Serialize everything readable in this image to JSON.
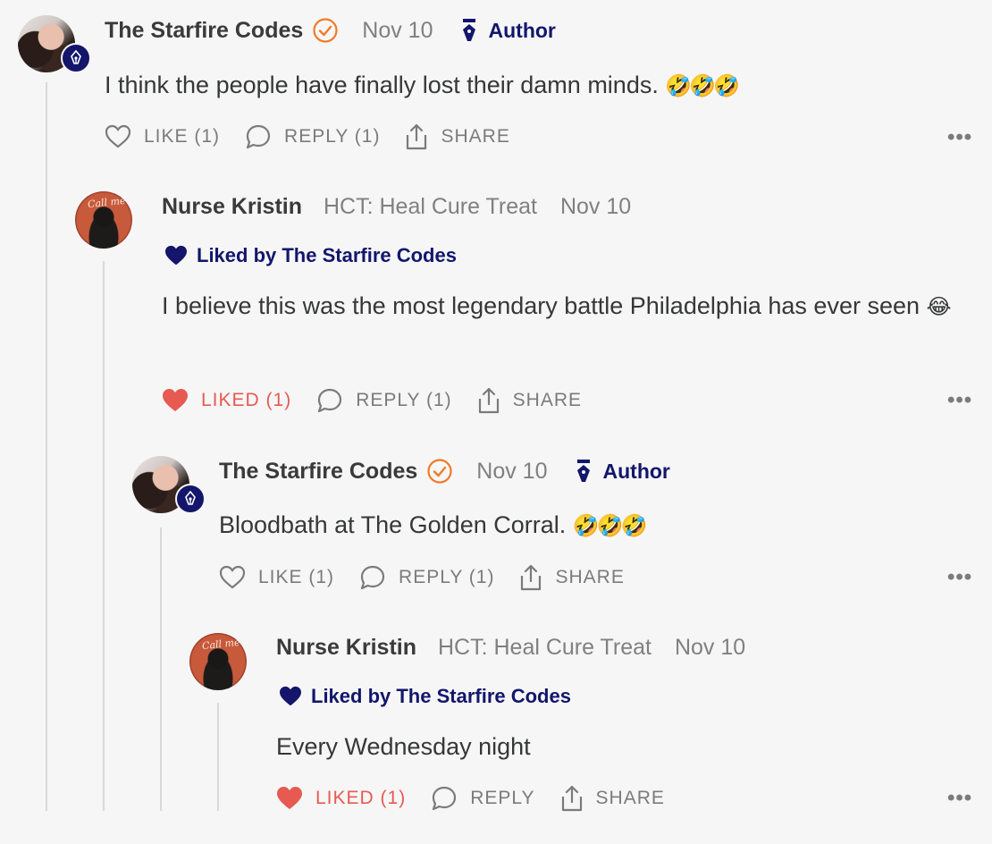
{
  "comments": [
    {
      "name": "The Starfire Codes",
      "date": "Nov 10",
      "author_label": "Author",
      "body": "I think the people have finally lost their damn minds.",
      "emoji": "🤣🤣🤣",
      "actions": {
        "like": "LIKE (1)",
        "reply": "REPLY (1)",
        "share": "SHARE"
      },
      "more": "•••"
    },
    {
      "name": "Nurse Kristin",
      "publication": "HCT: Heal Cure Treat",
      "date": "Nov 10",
      "liked_by": "Liked by The Starfire Codes",
      "body": "I believe this was the most legendary battle Philadelphia has ever seen",
      "emoji": "😂",
      "actions": {
        "like": "LIKED (1)",
        "reply": "REPLY (1)",
        "share": "SHARE"
      },
      "more": "•••"
    },
    {
      "name": "The Starfire Codes",
      "date": "Nov 10",
      "author_label": "Author",
      "body": "Bloodbath at The Golden Corral.",
      "emoji": "🤣🤣🤣",
      "actions": {
        "like": "LIKE (1)",
        "reply": "REPLY (1)",
        "share": "SHARE"
      },
      "more": "•••"
    },
    {
      "name": "Nurse Kristin",
      "publication": "HCT: Heal Cure Treat",
      "date": "Nov 10",
      "liked_by": "Liked by The Starfire Codes",
      "body": "Every Wednesday night",
      "actions": {
        "like": "LIKED (1)",
        "reply": "REPLY",
        "share": "SHARE"
      },
      "more": "•••"
    }
  ],
  "colors": {
    "author_navy": "#13166b",
    "liked_red": "#e65a52",
    "verify_orange": "#f07a2a",
    "muted": "#808080"
  },
  "icons": [
    "pen-nib-icon",
    "check-badge-icon",
    "heart-icon",
    "comment-icon",
    "share-icon",
    "more-icon"
  ]
}
